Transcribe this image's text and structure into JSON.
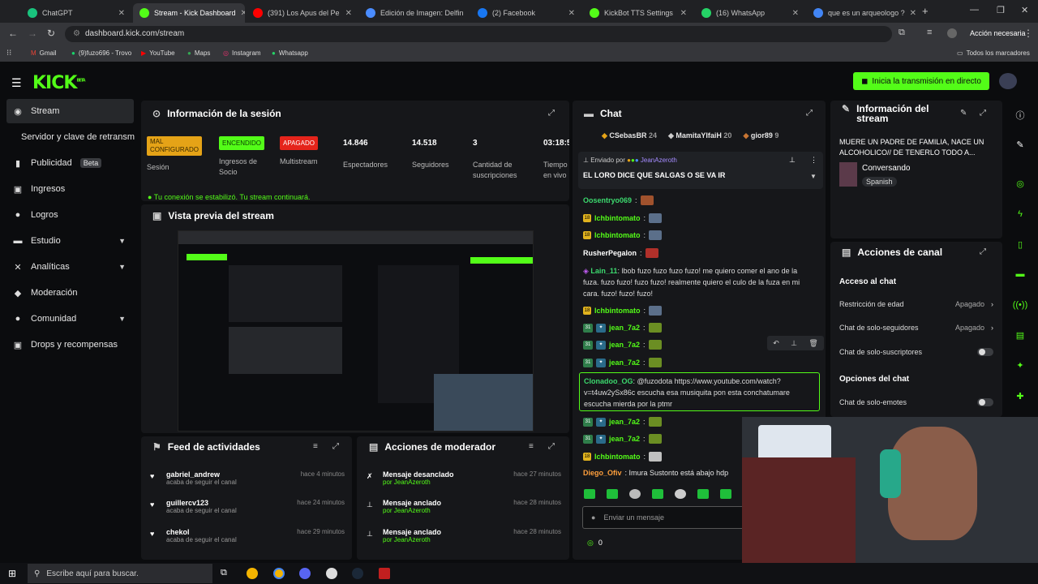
{
  "browser": {
    "tabs": [
      {
        "label": "ChatGPT",
        "color": "#19c37d"
      },
      {
        "label": "Stream - Kick Dashboard",
        "color": "#53fc18",
        "active": true
      },
      {
        "label": "(391) Los Apus del Pe",
        "color": "#ff0000"
      },
      {
        "label": "Edición de Imagen: Delfin",
        "color": "#4a8cff"
      },
      {
        "label": "(2) Facebook",
        "color": "#1877f2"
      },
      {
        "label": "KickBot TTS Settings",
        "color": "#53fc18"
      },
      {
        "label": "(16) WhatsApp",
        "color": "#25d366"
      },
      {
        "label": "que es un arqueologo ?",
        "color": "#4285f4"
      }
    ],
    "url": "dashboard.kick.com/stream",
    "account_label": "Acción necesaria",
    "bookmarks": [
      "Gmail",
      "(9)fuzo696 - Trovo",
      "YouTube",
      "Maps",
      "Instagram",
      "Whatsapp"
    ],
    "all_bookmarks": "Todos los marcadores"
  },
  "kick": {
    "logo": "KICK",
    "logo_tag": "BETA",
    "go_live": "Inicia la transmisión en directo"
  },
  "sidebar": {
    "items": [
      {
        "label": "Stream",
        "icon": "broadcast-icon",
        "glyph": "◉"
      },
      {
        "label": "Servidor y clave de retransm",
        "icon": "",
        "glyph": ""
      },
      {
        "label": "Publicidad",
        "icon": "megaphone-icon",
        "glyph": "▮",
        "badge": "Beta"
      },
      {
        "label": "Ingresos",
        "icon": "wallet-icon",
        "glyph": "▣"
      },
      {
        "label": "Logros",
        "icon": "trophy-icon",
        "glyph": "●"
      },
      {
        "label": "Estudio",
        "icon": "studio-icon",
        "glyph": "▬"
      },
      {
        "label": "Analíticas",
        "icon": "analytics-icon",
        "glyph": "✕"
      },
      {
        "label": "Moderación",
        "icon": "shield-icon",
        "glyph": "◆"
      },
      {
        "label": "Comunidad",
        "icon": "community-icon",
        "glyph": "●"
      },
      {
        "label": "Drops y recompensas",
        "icon": "gift-icon",
        "glyph": "▣"
      }
    ]
  },
  "session": {
    "title": "Información de la sesión",
    "stats": [
      {
        "value": "MAL CONFIGURADO",
        "label": "Sesión",
        "badge_color": "#e5a317"
      },
      {
        "value": "ENCENDIDO",
        "label": "Ingresos de Socio",
        "badge_color": "#53fc18"
      },
      {
        "value": "APAGADO",
        "label": "Multistream",
        "badge_color": "#e5241b"
      },
      {
        "value": "14.846",
        "label": "Espectadores"
      },
      {
        "value": "14.518",
        "label": "Seguidores"
      },
      {
        "value": "3",
        "label": "Cantidad de suscripciones"
      },
      {
        "value": "03:18:5",
        "label": "Tiempo en vivo"
      }
    ],
    "notice": "Tu conexión se estabilizó. Tu stream continuará."
  },
  "preview": {
    "title": "Vista previa del stream"
  },
  "feed": {
    "title": "Feed de actividades",
    "items": [
      {
        "user": "gabriel_andrew",
        "action": "acaba de seguir el canal",
        "time": "hace 4 minutos"
      },
      {
        "user": "guillercv123",
        "action": "acaba de seguir el canal",
        "time": "hace 24 minutos"
      },
      {
        "user": "chekol",
        "action": "acaba de seguir el canal",
        "time": "hace 29 minutos"
      }
    ]
  },
  "modactions": {
    "title": "Acciones de moderador",
    "items": [
      {
        "action": "Mensaje desanclado",
        "by": "por JeanAzeroth",
        "time": "hace 27 minutos"
      },
      {
        "action": "Mensaje anclado",
        "by": "por JeanAzeroth",
        "time": "hace 28 minutos"
      },
      {
        "action": "Mensaje anclado",
        "by": "por JeanAzeroth",
        "time": "hace 28 minutos"
      }
    ]
  },
  "chat": {
    "title": "Chat",
    "top_gifters": [
      {
        "name": "CSebasBR",
        "count": "24"
      },
      {
        "name": "MamitaYIfaiH",
        "count": "20"
      },
      {
        "name": "gior89",
        "count": "9"
      }
    ],
    "pinned": {
      "sent_by": "Enviado por",
      "author": "JeanAzeroth",
      "text": "EL LORO DICE QUE SALGAS O SE VA IR"
    },
    "messages": [
      {
        "user": "Oosentryo069",
        "text": ":",
        "color": "#3cd96e",
        "emote": "#a0522d"
      },
      {
        "user": "Ichbintomato",
        "text": ":",
        "color": "#53fc18",
        "emote": "#5b6f8a"
      },
      {
        "user": "Ichbintomato",
        "text": ":",
        "color": "#53fc18",
        "emote": "#5b6f8a"
      },
      {
        "user": "RusherPegalon",
        "text": ":",
        "color": "#ffffff",
        "emote": "#b0302a"
      },
      {
        "user": "Lain_11",
        "text": ": lbob fuzo fuzo fuzo fuzo! me quiero comer el ano de la fuza. fuzo fuzo! fuzo fuzo! realmente quiero el culo de la fuza en mi cara. fuzo! fuzo! fuzo!",
        "color": "#3cd96e"
      },
      {
        "user": "Ichbintomato",
        "text": ":",
        "color": "#53fc18",
        "emote": "#5b6f8a"
      },
      {
        "user": "jean_7a2",
        "text": ":",
        "color": "#53fc18",
        "emote": "#6b8e23"
      },
      {
        "user": "jean_7a2",
        "text": ":",
        "color": "#53fc18",
        "emote": "#6b8e23"
      },
      {
        "user": "jean_7a2",
        "text": ":",
        "color": "#53fc18",
        "emote": "#6b8e23"
      },
      {
        "user": "Clonadoo_OG",
        "text": ": @fuzodota https://www.youtube.com/watch?v=t4uw2ySx86c escucha esa musiquita pon esta conchatumare escucha mierda por la ptmr",
        "color": "#3cd96e"
      },
      {
        "user": "jean_7a2",
        "text": ":",
        "color": "#53fc18",
        "emote": "#6b8e23"
      },
      {
        "user": "jean_7a2",
        "text": ":",
        "color": "#53fc18",
        "emote": "#6b8e23"
      },
      {
        "user": "Ichbintomato",
        "text": ":",
        "color": "#53fc18",
        "emote": "#c0c0c0"
      },
      {
        "user": "Diego_Ofiv",
        "text": ": Imura Sustonto está abajo hdp",
        "color": "#ff9f3c"
      }
    ],
    "input_placeholder": "Enviar un mensaje",
    "points": "0"
  },
  "stream_info": {
    "title": "Información del stream",
    "stream_title": "MUERE UN PADRE DE FAMILIA, NACE UN ALCOHOLICO// DE TENERLO TODO A...",
    "category": "Conversando",
    "language": "Spanish"
  },
  "channel_actions": {
    "title": "Acciones de canal",
    "chat_access": "Acceso al chat",
    "rows": [
      {
        "label": "Restricción de edad",
        "value": "Apagado"
      },
      {
        "label": "Chat de solo-seguidores",
        "value": "Apagado"
      },
      {
        "label": "Chat de solo-suscriptores",
        "value": ""
      }
    ],
    "chat_options": "Opciones del chat",
    "emotes_only": "Chat de solo-emotes"
  },
  "taskbar": {
    "search": "Escribe aquí para buscar."
  }
}
